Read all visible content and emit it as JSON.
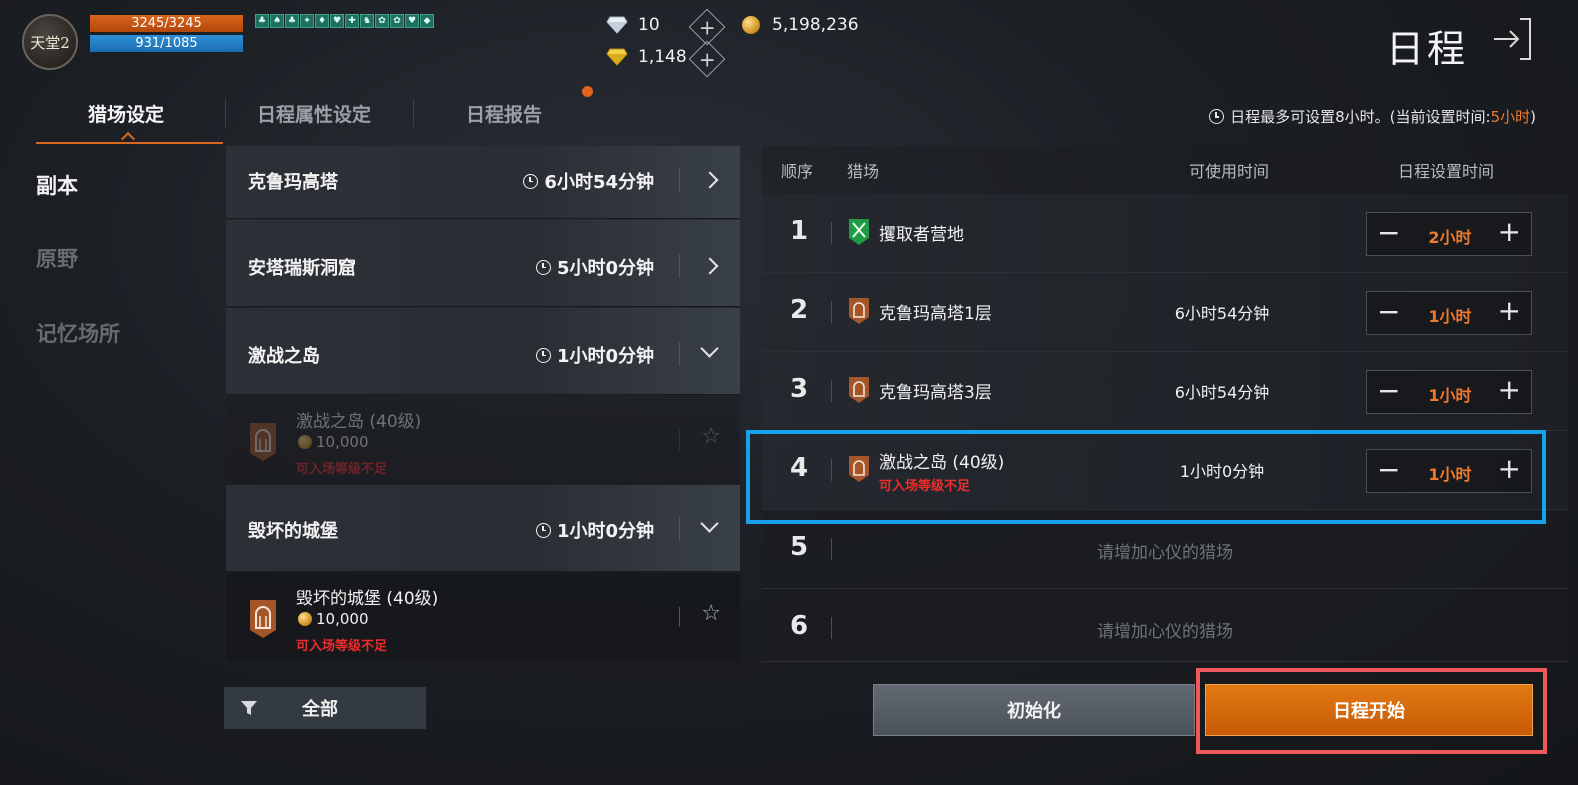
{
  "header": {
    "logo_text": "天堂2",
    "hp": "3245/3245",
    "mp": "931/1085",
    "buff_icons": [
      "buff-icon",
      "buff-icon",
      "buff-icon",
      "buff-icon",
      "buff-icon",
      "buff-icon",
      "buff-icon",
      "buff-icon",
      "buff-icon",
      "buff-icon",
      "buff-icon",
      "buff-icon"
    ],
    "diamond": "10",
    "gold": "5,198,236",
    "yellow_gem": "1,148",
    "title": "日程"
  },
  "tabs": [
    {
      "label": "猎场设定",
      "active": true
    },
    {
      "label": "日程属性设定",
      "active": false
    },
    {
      "label": "日程报告",
      "active": false
    }
  ],
  "notice": {
    "prefix": "日程最多可设置8小时。(当前设置时间:",
    "highlight": "5小时",
    "suffix": ")"
  },
  "nav": [
    {
      "label": "副本",
      "active": true
    },
    {
      "label": "原野",
      "active": false
    },
    {
      "label": "记忆场所",
      "active": false
    }
  ],
  "dungeons": {
    "categories": [
      {
        "name": "克鲁玛高塔",
        "time": "6小时54分钟",
        "state": "collapsed"
      },
      {
        "name": "安塔瑞斯洞窟",
        "time": "5小时0分钟",
        "state": "collapsed"
      },
      {
        "name": "激战之岛",
        "time": "1小时0分钟",
        "state": "expanded"
      },
      {
        "name": "毁坏的城堡",
        "time": "1小时0分钟",
        "state": "expanded"
      }
    ],
    "subitems": [
      {
        "name": "激战之岛 (40级)",
        "cost": "10,000",
        "warning": "可入场等级不足",
        "dim": true
      },
      {
        "name": "毁坏的城堡 (40级)",
        "cost": "10,000",
        "warning": "可入场等级不足",
        "dim": false
      }
    ],
    "filter_label": "全部"
  },
  "schedule": {
    "headers": {
      "order": "顺序",
      "field": "猎场",
      "available": "可使用时间",
      "set_time": "日程设置时间"
    },
    "rows": [
      {
        "num": "1",
        "name": "攫取者营地",
        "available": "",
        "set_time": "2小时",
        "icon": "crossed-swords-icon",
        "warning": ""
      },
      {
        "num": "2",
        "name": "克鲁玛高塔1层",
        "available": "6小时54分钟",
        "set_time": "1小时",
        "icon": "tower-gate-icon",
        "warning": ""
      },
      {
        "num": "3",
        "name": "克鲁玛高塔3层",
        "available": "6小时54分钟",
        "set_time": "1小时",
        "icon": "tower-gate-icon",
        "warning": ""
      },
      {
        "num": "4",
        "name": "激战之岛 (40级)",
        "available": "1小时0分钟",
        "set_time": "1小时",
        "icon": "tower-gate-icon",
        "warning": "可入场等级不足"
      }
    ],
    "empty_rows": [
      {
        "num": "5",
        "text": "请增加心仪的猎场"
      },
      {
        "num": "6",
        "text": "请增加心仪的猎场"
      }
    ]
  },
  "buttons": {
    "reset": "初始化",
    "start": "日程开始"
  },
  "colors": {
    "accent": "#ee7a2e",
    "warning": "#ee2c2c",
    "highlight_blue": "#18a0ea",
    "highlight_red": "#f0575d"
  }
}
